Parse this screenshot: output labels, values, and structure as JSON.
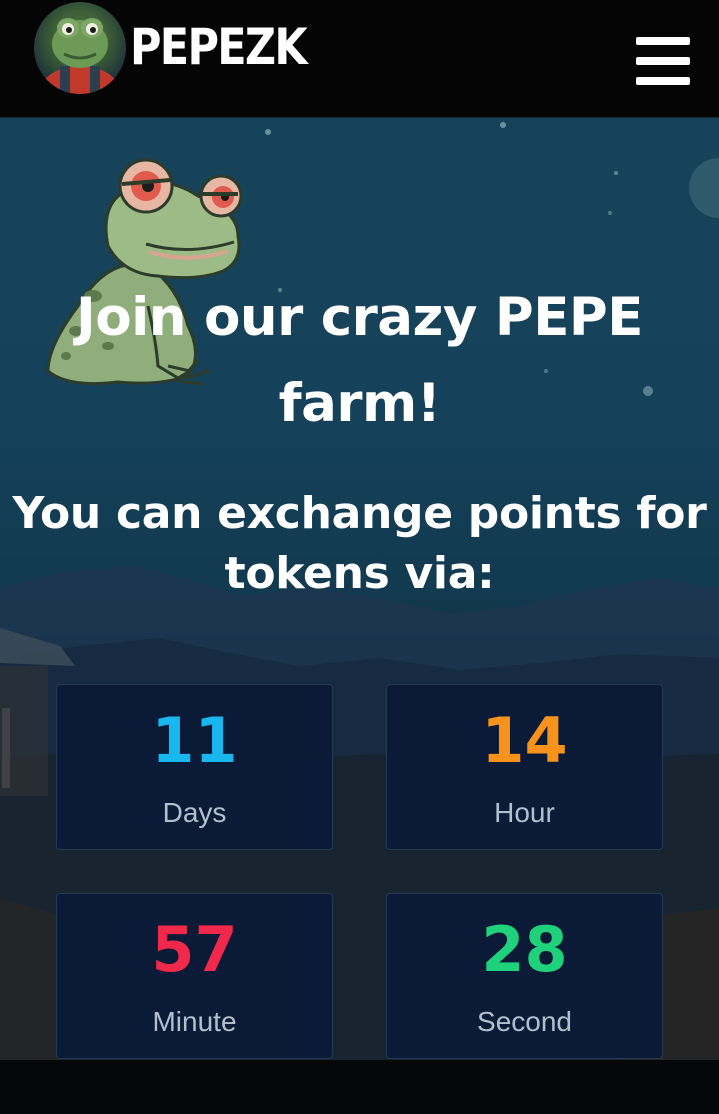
{
  "header": {
    "logo_text": "PEPEZK",
    "logo_icon": "pepe-avatar-icon",
    "menu_icon": "hamburger-menu-icon"
  },
  "hero": {
    "title": "Join our crazy PEPE farm!",
    "subtitle": "You can exchange points for tokens via:",
    "mascot_icon": "frog-mascot-icon"
  },
  "countdown": {
    "days": {
      "value": "11",
      "label": "Days",
      "color": "#19b7f0"
    },
    "hours": {
      "value": "14",
      "label": "Hour",
      "color": "#f7931a"
    },
    "minutes": {
      "value": "57",
      "label": "Minute",
      "color": "#f0284a"
    },
    "seconds": {
      "value": "28",
      "label": "Second",
      "color": "#1fd17a"
    }
  },
  "colors": {
    "header_bg": "#050505",
    "hero_bg": "#15425a",
    "box_bg": "#0b1a36",
    "text": "#ffffff",
    "label": "#b3c0cc"
  }
}
